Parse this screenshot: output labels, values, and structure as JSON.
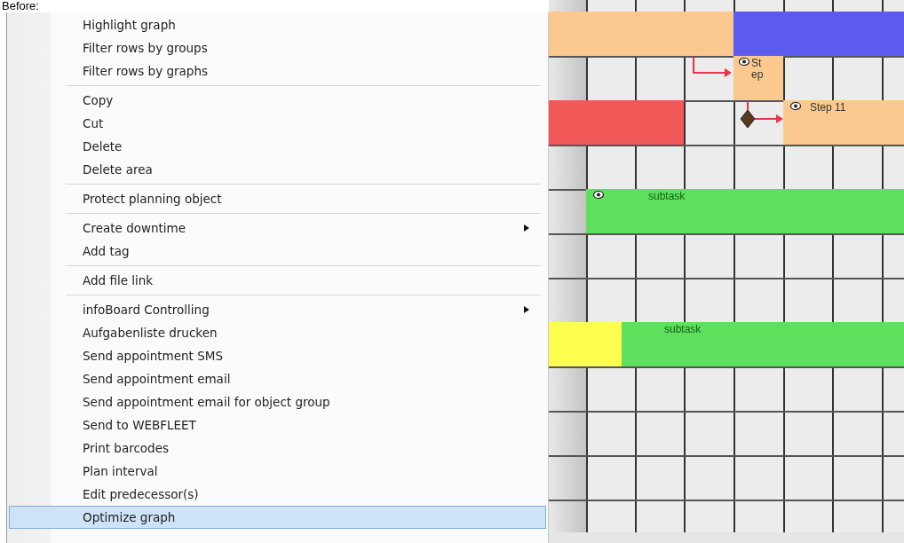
{
  "caption": "Before:",
  "context_menu": {
    "items": [
      {
        "kind": "item",
        "label": "Highlight graph",
        "submenu": false,
        "selected": false
      },
      {
        "kind": "item",
        "label": "Filter rows by groups",
        "submenu": false,
        "selected": false
      },
      {
        "kind": "item",
        "label": "Filter rows by graphs",
        "submenu": false,
        "selected": false
      },
      {
        "kind": "separator"
      },
      {
        "kind": "item",
        "label": "Copy",
        "submenu": false,
        "selected": false
      },
      {
        "kind": "item",
        "label": "Cut",
        "submenu": false,
        "selected": false
      },
      {
        "kind": "item",
        "label": "Delete",
        "submenu": false,
        "selected": false
      },
      {
        "kind": "item",
        "label": "Delete area",
        "submenu": false,
        "selected": false
      },
      {
        "kind": "separator"
      },
      {
        "kind": "item",
        "label": "Protect planning object",
        "submenu": false,
        "selected": false
      },
      {
        "kind": "separator"
      },
      {
        "kind": "item",
        "label": "Create downtime",
        "submenu": true,
        "selected": false
      },
      {
        "kind": "item",
        "label": "Add tag",
        "submenu": false,
        "selected": false
      },
      {
        "kind": "separator"
      },
      {
        "kind": "item",
        "label": "Add file link",
        "submenu": false,
        "selected": false
      },
      {
        "kind": "separator"
      },
      {
        "kind": "item",
        "label": "infoBoard Controlling",
        "submenu": true,
        "selected": false
      },
      {
        "kind": "item",
        "label": "Aufgabenliste drucken",
        "submenu": false,
        "selected": false
      },
      {
        "kind": "item",
        "label": "Send appointment SMS",
        "submenu": false,
        "selected": false
      },
      {
        "kind": "item",
        "label": "Send appointment email",
        "submenu": false,
        "selected": false
      },
      {
        "kind": "item",
        "label": "Send appointment email for object group",
        "submenu": false,
        "selected": false
      },
      {
        "kind": "item",
        "label": "Send to WEBFLEET",
        "submenu": false,
        "selected": false
      },
      {
        "kind": "item",
        "label": "Print barcodes",
        "submenu": false,
        "selected": false
      },
      {
        "kind": "item",
        "label": "Plan interval",
        "submenu": false,
        "selected": false
      },
      {
        "kind": "item",
        "label": "Edit predecessor(s)",
        "submenu": false,
        "selected": false
      },
      {
        "kind": "item",
        "label": "Optimize graph",
        "submenu": false,
        "selected": true
      }
    ]
  },
  "gantt": {
    "bars": [
      {
        "color": "#fbc98f",
        "icon": false
      },
      {
        "color": "#5b5bf0",
        "icon": false
      },
      {
        "color": "#fbc98f",
        "label": "Step",
        "icon": true
      },
      {
        "color": "#f25a5a",
        "icon": false
      },
      {
        "color": "#fbc98f",
        "label": "Step 11",
        "icon": true
      },
      {
        "color": "#5ee05e",
        "label": "subtask",
        "icon": true
      },
      {
        "color": "#ffff50",
        "icon": false
      },
      {
        "color": "#5ee05e",
        "label": "subtask",
        "icon": false
      }
    ]
  }
}
